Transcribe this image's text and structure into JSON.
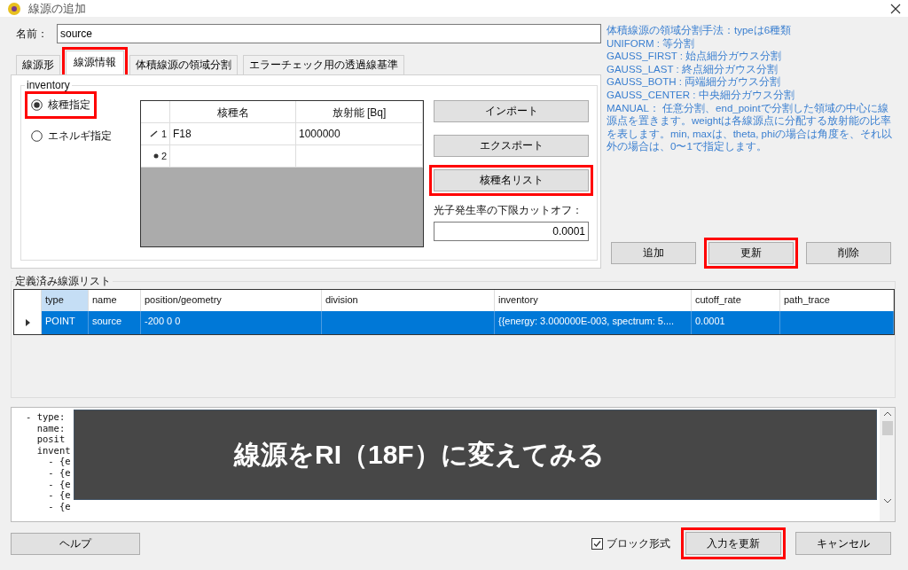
{
  "window": {
    "title": "線源の追加"
  },
  "name_field": {
    "label": "名前：",
    "value": "source"
  },
  "tabs": [
    {
      "label": "線源形",
      "selected": false,
      "highlighted": false
    },
    {
      "label": "線源情報",
      "selected": true,
      "highlighted": true
    },
    {
      "label": "体積線源の領域分割",
      "selected": false,
      "highlighted": false
    },
    {
      "label": "エラーチェック用の透過線基準",
      "selected": false,
      "highlighted": false
    }
  ],
  "inventory": {
    "legend": "inventory",
    "radios": [
      {
        "label": "核種指定",
        "selected": true,
        "highlighted": true
      },
      {
        "label": "エネルギ指定",
        "selected": false,
        "highlighted": false
      }
    ],
    "grid": {
      "columns": [
        "核種名",
        "放射能 [Bq]"
      ],
      "rows": [
        {
          "kind": "editing",
          "number": "1",
          "cells": [
            "F18",
            "1000000"
          ]
        },
        {
          "kind": "new",
          "number": "2",
          "cells": []
        }
      ]
    },
    "buttons": [
      {
        "label": "インポート",
        "highlighted": false
      },
      {
        "label": "エクスポート",
        "highlighted": false
      },
      {
        "label": "核種名リスト",
        "highlighted": true
      }
    ],
    "cutoff": {
      "label": "光子発生率の下限カットオフ：",
      "value": "0.0001"
    }
  },
  "help_text": [
    "体積線源の領域分割手法：typeは6種類",
    "UNIFORM : 等分割",
    "GAUSS_FIRST : 始点細分ガウス分割",
    "GAUSS_LAST : 終点細分ガウス分割",
    "GAUSS_BOTH : 両端細分ガウス分割",
    "GAUSS_CENTER : 中央細分ガウス分割",
    "MANUAL： 任意分割、end_pointで分割した領域の中心に線源点を置きます。weightは各線源点に分配する放射能の比率を表します。min, maxは、theta, phiの場合は角度を、それ以外の場合は、0〜1で指定します。"
  ],
  "action_buttons": [
    {
      "label": "追加",
      "highlighted": false
    },
    {
      "label": "更新",
      "highlighted": true
    },
    {
      "label": "削除",
      "highlighted": false
    }
  ],
  "source_list": {
    "legend": "定義済み線源リスト",
    "columns": [
      {
        "label": "type",
        "selected": true
      },
      {
        "label": "name",
        "selected": false
      },
      {
        "label": "position/geometry",
        "selected": false
      },
      {
        "label": "division",
        "selected": false
      },
      {
        "label": "inventory",
        "selected": false
      },
      {
        "label": "cutoff_rate",
        "selected": false
      },
      {
        "label": "path_trace",
        "selected": false
      }
    ],
    "rows": [
      {
        "selected": true,
        "cells": [
          "POINT",
          "source",
          "-200 0 0",
          null,
          "{{energy: 3.000000E-003, spectrum: 5....",
          "0.0001",
          null
        ]
      }
    ]
  },
  "yaml_lines": [
    "- type:",
    "  name:",
    "  posit",
    "  invent",
    "    - {e",
    "    - {e",
    "    - {e",
    "    - {e",
    "    - {e"
  ],
  "caption": "線源をRI（18F）に変えてみる",
  "footer": {
    "help_button": "ヘルプ",
    "block_format": {
      "label": "ブロック形式",
      "checked": true
    },
    "buttons": [
      {
        "label": "入力を更新",
        "highlighted": true
      },
      {
        "label": "キャンセル",
        "highlighted": false
      }
    ]
  }
}
